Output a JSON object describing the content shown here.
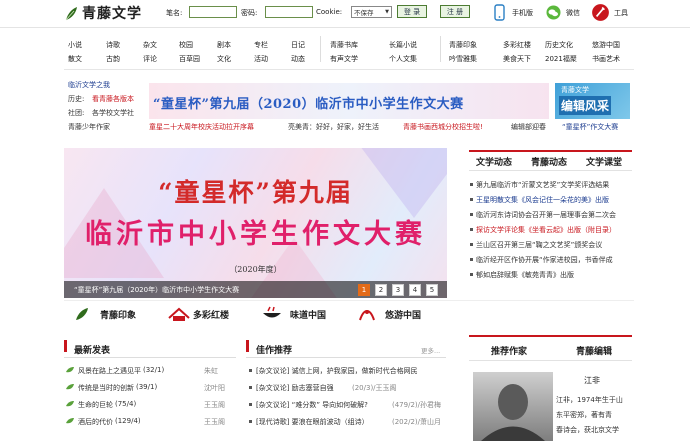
{
  "brand": {
    "name": "青藤文学"
  },
  "login": {
    "username_label": "笔名:",
    "password_label": "密码:",
    "cookie_label": "Cookie:",
    "cookie_value": "不保存",
    "login_button": "登 录",
    "register_button": "注 册"
  },
  "top_tools": [
    {
      "label": "手机版",
      "icon": "phone-icon"
    },
    {
      "label": "微信",
      "icon": "wechat-icon"
    },
    {
      "label": "工具",
      "icon": "tools-icon"
    }
  ],
  "nav": {
    "row1": [
      "小说",
      "诗歌",
      "杂文",
      "校园",
      "剧本",
      "专栏",
      "日记",
      "青藤书库",
      "长篇小说",
      "青藤印象",
      "多彩红楼",
      "历史文化",
      "悠游中国"
    ],
    "row2": [
      "散文",
      "古韵",
      "评论",
      "百草园",
      "文化",
      "活动",
      "动态",
      "有声文学",
      "个人文集",
      "吟雪雅集",
      "美食天下",
      "2021福聚",
      "书画艺术"
    ]
  },
  "news_strip": {
    "left_items": [
      {
        "label": "临沂文学之我",
        "tag": ""
      },
      {
        "label": "看青藤各版本",
        "tag": "历史:"
      },
      {
        "label": "各学校文学社",
        "tag": "社团:"
      },
      {
        "label": "青藤少年作家",
        "tag": ""
      }
    ],
    "bottom_row": [
      "童星二十大周年校庆活动拉开序幕",
      "亮美青：好好，好家，好生活",
      "青藤书画西城分校招生啦!",
      "编辑部迎春",
      "“童星杯”作文大赛"
    ]
  },
  "thin_banner": {
    "title": "“童星杯”第九届（2020）临沂市中小学生作文大赛"
  },
  "right_banner": {
    "line1": "青藤文学",
    "line2": "编辑风采"
  },
  "main_banner": {
    "title_line1": "“童星杯”第九届",
    "title_line2": "临沂市中小学生作文大赛",
    "year": "（2020年度）",
    "caption": "“童星杯”第九届（2020年）临沂市中小学生作文大赛",
    "pages": [
      "1",
      "2",
      "3",
      "4",
      "5"
    ],
    "active_page": "1"
  },
  "right_tabs": {
    "tabs": [
      "文学动态",
      "青藤动态",
      "文学课堂"
    ],
    "items": [
      {
        "text": "第九届临沂市“沂蒙文艺奖”文学奖评选结果",
        "color": "#333333"
      },
      {
        "text": "王星明散文集《风会记住一朵花的美》出版",
        "color": "#1b3b8f"
      },
      {
        "text": "临沂河东诗词协会召开第一届理事会第二次会",
        "color": "#333333"
      },
      {
        "text": "探访文学评论集《坐看云起》出版（附目录）",
        "color": "#c8161d"
      },
      {
        "text": "兰山区召开第三届“鞠之文艺奖”颁奖会议",
        "color": "#333333"
      },
      {
        "text": "临沂经开区作协开展“作家进校园，书香伴成",
        "color": "#333333"
      },
      {
        "text": "郁如启辞赋集《敏苑青青》出版",
        "color": "#333333"
      }
    ]
  },
  "categories": [
    "青藤印象",
    "多彩红楼",
    "味道中国",
    "悠游中国"
  ],
  "latest": {
    "title": "最新发表",
    "items": [
      {
        "title": "风景在路上之遇见平",
        "count": "(32/1)",
        "author": "朱虹"
      },
      {
        "title": "传统是当时的创新",
        "count": "(39/1)",
        "author": "沈叶阳"
      },
      {
        "title": "生命的巨轮",
        "count": "(75/4)",
        "author": "王玉阁"
      },
      {
        "title": "酒后的代价",
        "count": "(129/4)",
        "author": "王玉阁"
      }
    ]
  },
  "recommend": {
    "title": "佳作推荐",
    "more": "更多...",
    "items": [
      {
        "title": "[杂文议论] 诚信上网，护我家园，做新时代合格网民",
        "meta": ""
      },
      {
        "title": "[杂文议论] 励志塞营自强",
        "meta": "(20/3)/王玉阁"
      },
      {
        "title": "[杂文议论] “难分数” 导向如何破解?",
        "meta": "(479/2)/孙君梅"
      },
      {
        "title": "[现代诗歌] 要浪在眼前波动（组诗）",
        "meta": "(202/2)/萧山月"
      }
    ]
  },
  "authors": {
    "tabs": [
      "推荐作家",
      "青藤编辑"
    ],
    "name": "江非",
    "bio_lines": [
      "江非，1974年生于山",
      "东平密郑，著有青",
      "春诗会，获北京文学"
    ]
  },
  "colors": {
    "brand_green": "#2f6b1c",
    "accent_red": "#c8161d",
    "link_blue": "#1b3b8f",
    "active_orange": "#e36b18"
  }
}
